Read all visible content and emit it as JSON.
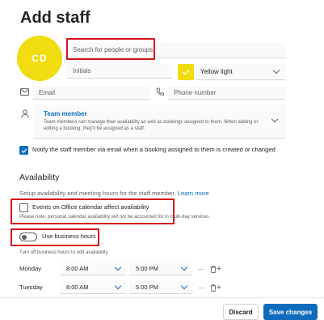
{
  "page": {
    "title": "Add staff"
  },
  "avatar": {
    "initials": "CD"
  },
  "search": {
    "placeholder": "Search for people or groups"
  },
  "initials_field": {
    "placeholder": "Initials"
  },
  "color": {
    "selected": "Yellow light",
    "swatch_color": "#f1dc12"
  },
  "email": {
    "placeholder": "Email",
    "icon": "mail-icon"
  },
  "phone": {
    "placeholder": "Phone number",
    "icon": "phone-icon"
  },
  "role": {
    "icon": "person-icon",
    "title": "Team member",
    "description": "Team members can manage their availability as well as bookings assigned to them. When adding or editing a booking, they'll be assigned as a staff."
  },
  "notify": {
    "checked": true,
    "label": "Notify the staff member via email when a booking assigned to them is created or changed"
  },
  "availability": {
    "heading": "Availability",
    "description": "Setup availability and meeting hours for the staff member.",
    "link": "Learn more"
  },
  "office_calendar": {
    "checked": false,
    "label": "Events on Office calendar affect availability",
    "note": "Please note, personal calendar availability will not be accounted for in multi-day services."
  },
  "business_hours": {
    "on": false,
    "label": "Use business hours",
    "hint": "Turn off business hours to edit availability"
  },
  "schedule": [
    {
      "day": "Monday",
      "start": "8:00 AM",
      "end": "5:00 PM"
    },
    {
      "day": "Tuesday",
      "start": "8:00 AM",
      "end": "5:00 PM"
    }
  ],
  "footer": {
    "discard": "Discard",
    "save": "Save changes"
  },
  "accent_color": "#0f6cbd",
  "highlight_color": "#d4141c"
}
